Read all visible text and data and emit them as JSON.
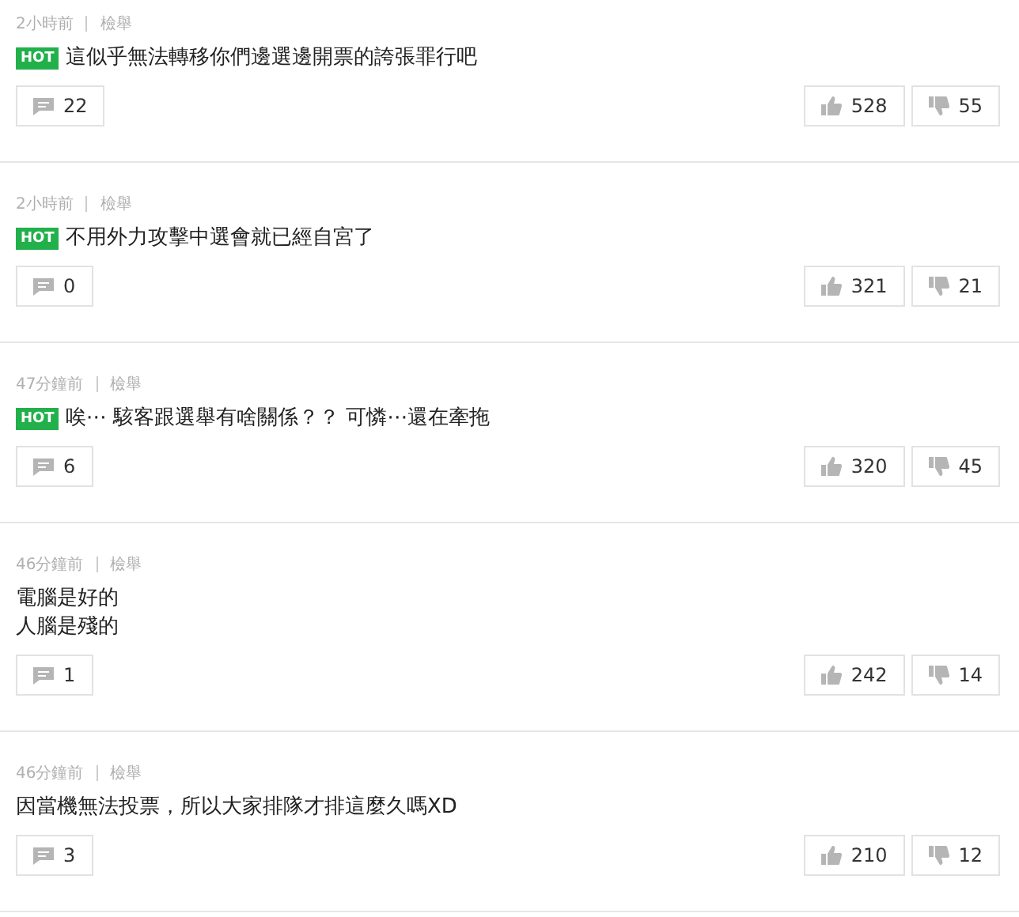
{
  "comments": [
    {
      "time": "2小時前",
      "report": "檢舉",
      "hot": true,
      "hot_label": "HOT",
      "lines": [
        "這似乎無法轉移你們邊選邊開票的誇張罪行吧"
      ],
      "replies": "22",
      "likes": "528",
      "dislikes": "55"
    },
    {
      "time": "2小時前",
      "report": "檢舉",
      "hot": true,
      "hot_label": "HOT",
      "lines": [
        "不用外力攻擊中選會就已經自宮了"
      ],
      "replies": "0",
      "likes": "321",
      "dislikes": "21"
    },
    {
      "time": "47分鐘前",
      "report": "檢舉",
      "hot": true,
      "hot_label": "HOT",
      "lines": [
        "唉⋯ 駭客跟選舉有啥關係？？ 可憐⋯還在牽拖"
      ],
      "replies": "6",
      "likes": "320",
      "dislikes": "45"
    },
    {
      "time": "46分鐘前",
      "report": "檢舉",
      "hot": false,
      "lines": [
        "電腦是好的",
        "人腦是殘的"
      ],
      "replies": "1",
      "likes": "242",
      "dislikes": "14"
    },
    {
      "time": "46分鐘前",
      "report": "檢舉",
      "hot": false,
      "lines": [
        "因當機無法投票，所以大家排隊才排這麼久嗎XD"
      ],
      "replies": "3",
      "likes": "210",
      "dislikes": "12"
    }
  ]
}
